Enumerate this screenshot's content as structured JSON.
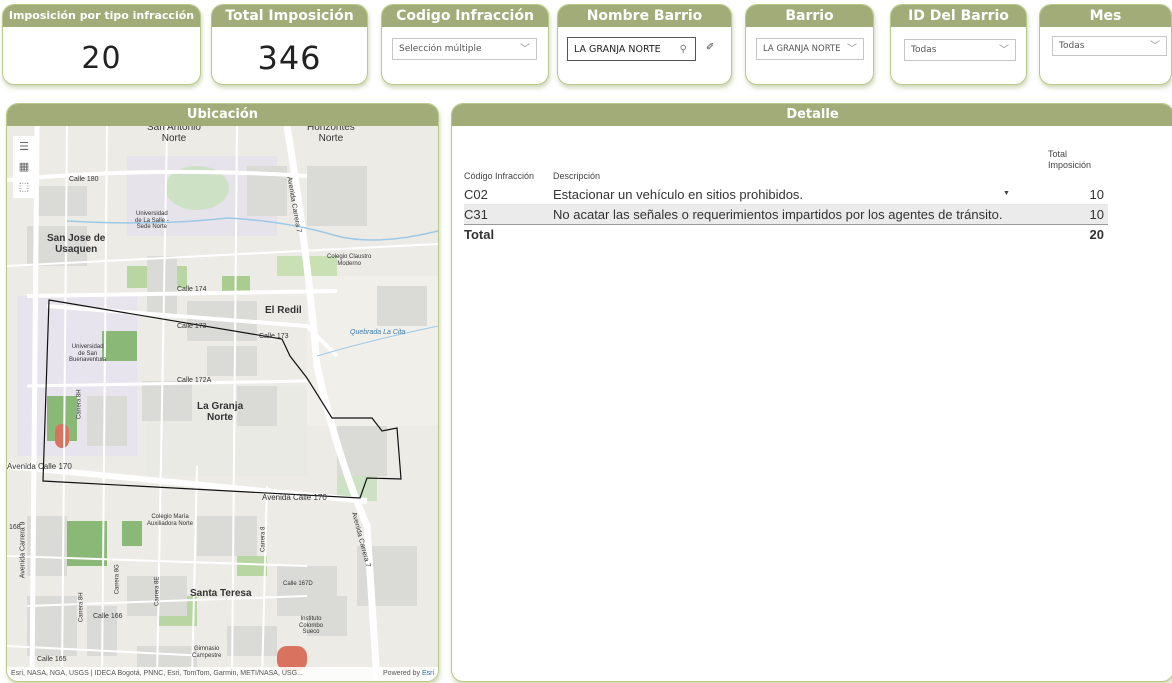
{
  "cards": {
    "impos_tipo": {
      "title": "Imposición por tipo infracción",
      "value": "20"
    },
    "total_impos": {
      "title": "Total Imposición",
      "value": "346"
    },
    "codigo": {
      "title": "Codigo Infracción",
      "value": "Selección múltiple"
    },
    "nombre_barrio": {
      "title": "Nombre Barrio",
      "value": "LA GRANJA NORTE"
    },
    "barrio": {
      "title": "Barrio",
      "value": "LA GRANJA NORTE"
    },
    "id_barrio": {
      "title": "ID Del Barrio",
      "value": "Todas"
    },
    "mes": {
      "title": "Mes",
      "value": "Todas"
    }
  },
  "map": {
    "title": "Ubicación",
    "labels": {
      "san_antonio": "San Antonio\nNorte",
      "horizontes": "Horizontes\nNorte",
      "calle180": "Calle 180",
      "univ_salle": "Universidad\nde La Salle -\nSede Norte",
      "san_jose": "San Jose de\nUsaquen",
      "colegio_claustro": "Colegio Claustro\nModerno",
      "calle174": "Calle 174",
      "el_redil": "El Redil",
      "calle173": "Calle 173",
      "calle173b": "Calle 173",
      "quebrada": "Quebrada La Cita",
      "univ_san_buen": "Universidad\nde San\nBuenaventura",
      "calle172a": "Calle 172A",
      "la_granja": "La Granja\nNorte",
      "carrera8h": "Carrera 8H",
      "av_calle170_left": "Avenida Calle 170",
      "av_calle170": "Avenida Calle 170",
      "av_carrera7_top": "Avenida Carrera 7",
      "av_carrera7_bot": "Avenida Carrera 7",
      "colegio_maria": "Colegio María\nAuxiliadora Norte",
      "av_carrera9": "Avenida Carrera 9",
      "carrera8g": "Carrera 8G",
      "carrera8e": "Carrera 8E",
      "carrera8": "Carrera 8",
      "calle167d": "Calle 167D",
      "santa_teresa": "Santa Teresa",
      "carrera8h_b": "Carrera 8H",
      "calle166": "Calle 166",
      "instituto": "Instituto\nColombo\nSueco",
      "gimnasio": "Gimnasio\nCampestre",
      "calle165": "Calle 165",
      "n168": "168"
    },
    "attribution": "Esri, NASA, NGA, USGS | IDECA Bogotá, PNNC, Esri, TomTom, Garmin, METI/NASA, USG...",
    "powered_prefix": "Powered by",
    "powered_brand": "Esri",
    "tools": [
      "menu-icon",
      "qr-icon",
      "select-icon"
    ]
  },
  "detalle": {
    "title": "Detalle",
    "columns": [
      "Código Infracción",
      "Descripción",
      "Total\nImposición"
    ],
    "rows": [
      {
        "code": "C02",
        "desc": "Estacionar un vehículo en sitios prohibidos.",
        "total": "10"
      },
      {
        "code": "C31",
        "desc": "No acatar las señales o requerimientos impartidos por los agentes de tránsito.",
        "total": "10"
      }
    ],
    "total_label": "Total",
    "total_value": "20"
  },
  "colors": {
    "header": "#a1ac79",
    "border": "#b9c98a",
    "highlight": "#ebebeb"
  }
}
